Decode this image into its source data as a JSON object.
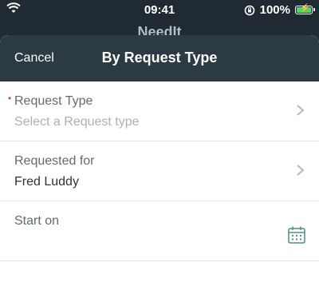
{
  "status_bar": {
    "time": "09:41",
    "battery_text": "100%",
    "battery_color": "#4cd964"
  },
  "background_title": "NeedIt",
  "sheet": {
    "cancel_label": "Cancel",
    "title": "By Request Type"
  },
  "form": {
    "request_type": {
      "label": "Request Type",
      "required": true,
      "placeholder": "Select a Request type"
    },
    "requested_for": {
      "label": "Requested for",
      "value": "Fred Luddy"
    },
    "start_on": {
      "label": "Start on",
      "value": ""
    }
  },
  "icons": {
    "wifi": "wifi-icon",
    "orientation_lock": "orientation-lock-icon",
    "battery": "battery-icon",
    "chevron": "chevron-right-icon",
    "calendar": "calendar-icon"
  },
  "colors": {
    "header_bg": "#2b3a43",
    "required": "#d0463d",
    "calendar_accent": "#4f8f8b"
  }
}
